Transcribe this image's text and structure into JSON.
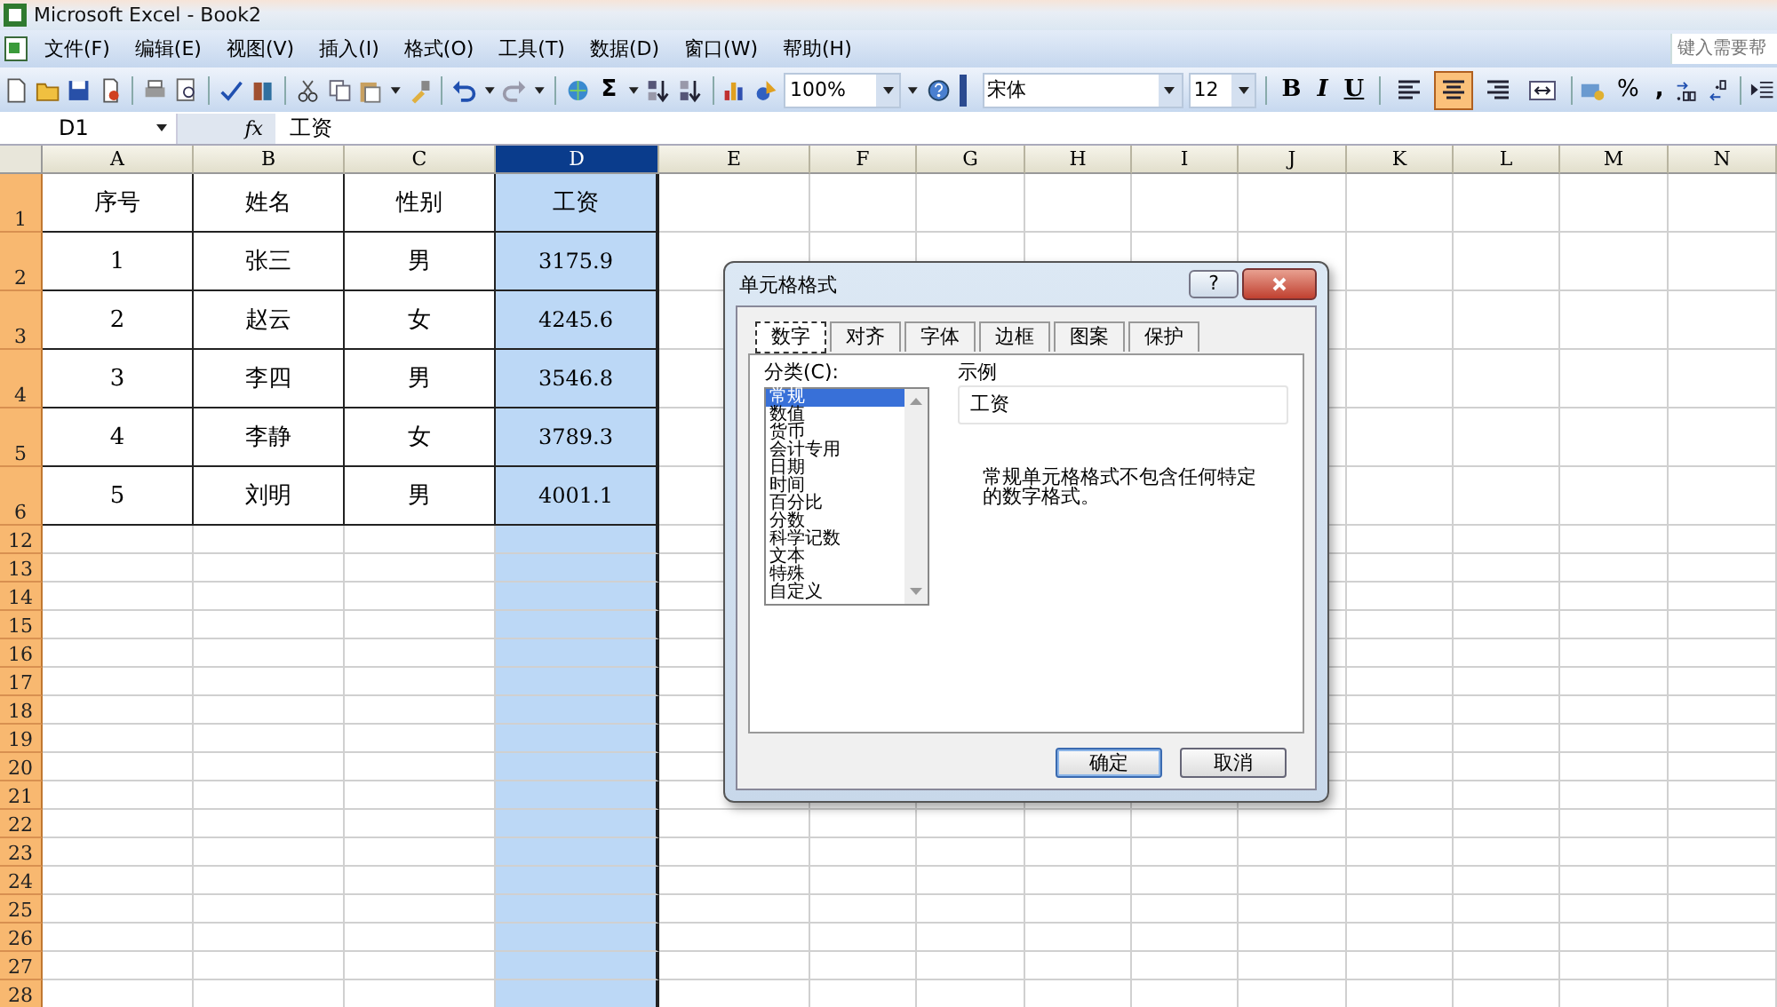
{
  "window": {
    "title": "Microsoft Excel - Book2"
  },
  "menu": [
    "文件(F)",
    "编辑(E)",
    "视图(V)",
    "插入(I)",
    "格式(O)",
    "工具(T)",
    "数据(D)",
    "窗口(W)",
    "帮助(H)"
  ],
  "help_box": {
    "placeholder": "键入需要帮"
  },
  "toolbar": {
    "sum": "Σ",
    "zoom": "100%",
    "font": "宋体",
    "font_size": "12",
    "bold": "B",
    "italic": "I",
    "underline": "U",
    "alignment_buttons": [
      {
        "selected": false
      },
      {
        "selected": true
      },
      {
        "selected": false
      },
      {
        "selected": false
      }
    ],
    "percent": "%",
    "comma": ","
  },
  "formula_bar": {
    "name_box": "D1",
    "fx": "fx",
    "value": "工资"
  },
  "sheet": {
    "columns": [
      {
        "label": "A",
        "selected": false
      },
      {
        "label": "B",
        "selected": false
      },
      {
        "label": "C",
        "selected": false
      },
      {
        "label": "D",
        "selected": true
      },
      {
        "label": "E",
        "selected": false
      },
      {
        "label": "F",
        "selected": false
      },
      {
        "label": "G",
        "selected": false
      },
      {
        "label": "H",
        "selected": false
      },
      {
        "label": "I",
        "selected": false
      },
      {
        "label": "J",
        "selected": false
      },
      {
        "label": "K",
        "selected": false
      },
      {
        "label": "L",
        "selected": false
      },
      {
        "label": "M",
        "selected": false
      },
      {
        "label": "N",
        "selected": false
      }
    ],
    "rows": [
      {
        "label": "1",
        "cells": [
          "序号",
          "姓名",
          "性别",
          "工资"
        ]
      },
      {
        "label": "2",
        "cells": [
          "1",
          "张三",
          "男",
          "3175.9"
        ]
      },
      {
        "label": "3",
        "cells": [
          "2",
          "赵云",
          "女",
          "4245.6"
        ]
      },
      {
        "label": "4",
        "cells": [
          "3",
          "李四",
          "男",
          "3546.8"
        ]
      },
      {
        "label": "5",
        "cells": [
          "4",
          "李静",
          "女",
          "3789.3"
        ]
      },
      {
        "label": "6",
        "cells": [
          "5",
          "刘明",
          "男",
          "4001.1"
        ]
      },
      {
        "label": "12",
        "cells": []
      },
      {
        "label": "13",
        "cells": []
      },
      {
        "label": "14",
        "cells": []
      },
      {
        "label": "15",
        "cells": []
      },
      {
        "label": "16",
        "cells": []
      },
      {
        "label": "17",
        "cells": []
      },
      {
        "label": "18",
        "cells": []
      },
      {
        "label": "19",
        "cells": []
      },
      {
        "label": "20",
        "cells": []
      },
      {
        "label": "21",
        "cells": []
      },
      {
        "label": "22",
        "cells": []
      },
      {
        "label": "23",
        "cells": []
      },
      {
        "label": "24",
        "cells": []
      },
      {
        "label": "25",
        "cells": []
      },
      {
        "label": "26",
        "cells": []
      },
      {
        "label": "27",
        "cells": []
      },
      {
        "label": "28",
        "cells": []
      }
    ]
  },
  "dialog": {
    "title": "单元格格式",
    "help": "?",
    "tabs": [
      {
        "label": "数字",
        "selected": true
      },
      {
        "label": "对齐",
        "selected": false
      },
      {
        "label": "字体",
        "selected": false
      },
      {
        "label": "边框",
        "selected": false
      },
      {
        "label": "图案",
        "selected": false
      },
      {
        "label": "保护",
        "selected": false
      }
    ],
    "category_label": "分类(C):",
    "categories": [
      {
        "label": "常规",
        "selected": true
      },
      {
        "label": "数值",
        "selected": false
      },
      {
        "label": "货币",
        "selected": false
      },
      {
        "label": "会计专用",
        "selected": false
      },
      {
        "label": "日期",
        "selected": false
      },
      {
        "label": "时间",
        "selected": false
      },
      {
        "label": "百分比",
        "selected": false
      },
      {
        "label": "分数",
        "selected": false
      },
      {
        "label": "科学记数",
        "selected": false
      },
      {
        "label": "文本",
        "selected": false
      },
      {
        "label": "特殊",
        "selected": false
      },
      {
        "label": "自定义",
        "selected": false
      }
    ],
    "sample_label": "示例",
    "sample_value": "工资",
    "description": "常规单元格格式不包含任何特定的数字格式。",
    "buttons": [
      "确定",
      "取消"
    ]
  }
}
